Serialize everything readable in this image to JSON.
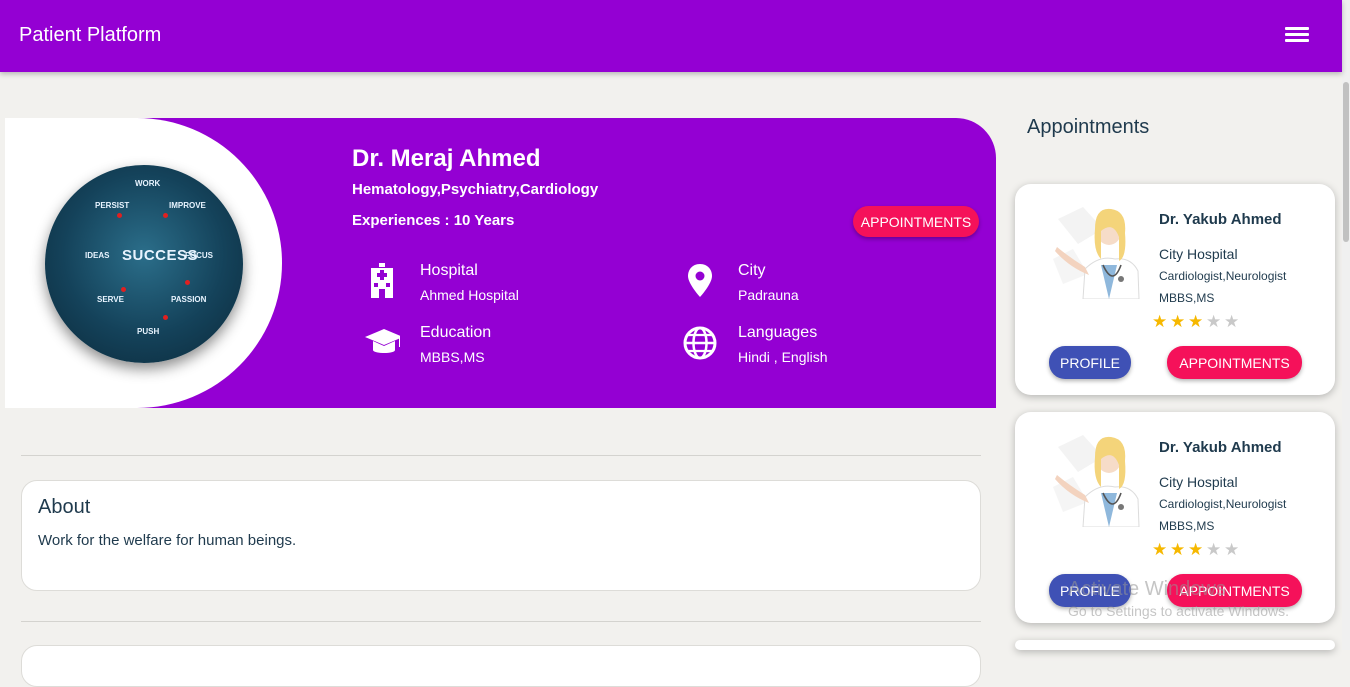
{
  "navbar": {
    "brand": "Patient Platform",
    "menu_icon": "hamburger-menu-icon",
    "color": "#9400d3"
  },
  "profile": {
    "name": "Dr. Meraj Ahmed",
    "specialties": "Hematology,Psychiatry,Cardiology",
    "experience": "Experiences : 10 Years",
    "appointments_button": "APPOINTMENTS",
    "photo_words": [
      "WORK",
      "IMPROVE",
      "PERSIST",
      "SUCCESS",
      "IDEAS",
      "FOCUS",
      "SERVE",
      "PASSION",
      "PUSH"
    ],
    "info": {
      "hospital": {
        "label": "Hospital",
        "value": "Ahmed Hospital",
        "icon": "hospital-building-icon"
      },
      "city": {
        "label": "City",
        "value": "Padrauna",
        "icon": "map-pin-icon"
      },
      "education": {
        "label": "Education",
        "value": "MBBS,MS",
        "icon": "graduation-cap-icon"
      },
      "languages": {
        "label": "Languages",
        "value": "Hindi , English",
        "icon": "globe-icon"
      }
    }
  },
  "about": {
    "title": "About",
    "text": "Work for the welfare for human beings."
  },
  "sidebar": {
    "title": "Appointments",
    "cards": [
      {
        "name": "Dr. Yakub Ahmed",
        "hospital": "City Hospital",
        "specialty": "Cardiologist,Neurologist",
        "degree": "MBBS,MS",
        "rating": 3,
        "rating_max": 5,
        "profile_button": "PROFILE",
        "appointments_button": "APPOINTMENTS"
      },
      {
        "name": "Dr. Yakub Ahmed",
        "hospital": "City Hospital",
        "specialty": "Cardiologist,Neurologist",
        "degree": "MBBS,MS",
        "rating": 3,
        "rating_max": 5,
        "profile_button": "PROFILE",
        "appointments_button": "APPOINTMENTS"
      }
    ]
  },
  "watermark": {
    "line1": "Activate Windows",
    "line2": "Go to Settings to activate Windows."
  },
  "colors": {
    "primary": "#9400d3",
    "appointment_button": "#f5115a",
    "profile_button": "#3f51b5",
    "star_on": "#f6b800",
    "star_off": "#c9c9c9"
  }
}
